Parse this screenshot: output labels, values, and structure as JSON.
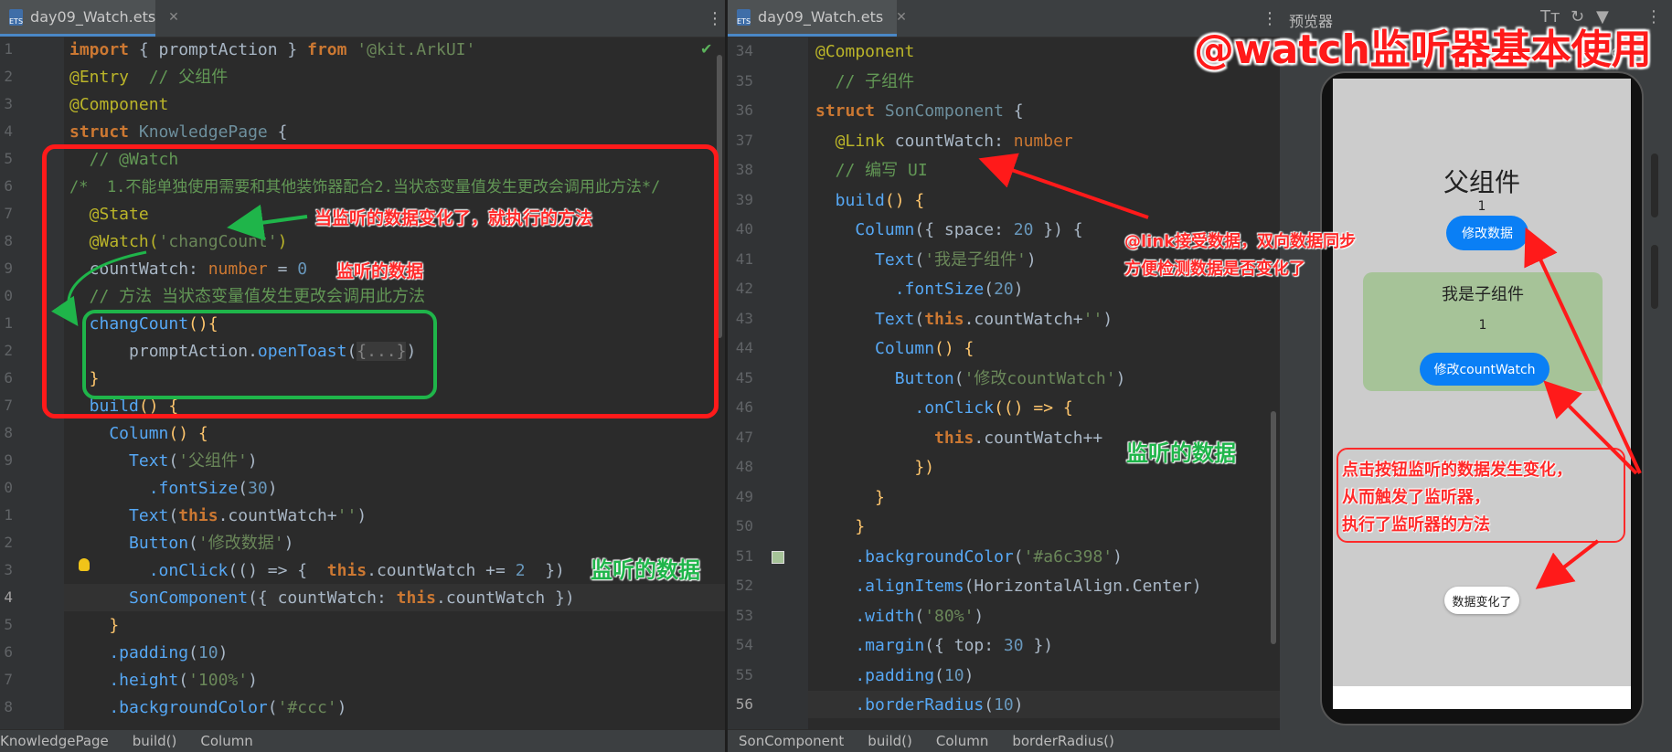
{
  "left_editor": {
    "tab": "day09_Watch.ets",
    "lines": [
      "1",
      "2",
      "3",
      "4",
      "5",
      "6",
      "7",
      "8",
      "9",
      "0",
      "1",
      "2",
      "6",
      "7",
      "8",
      "9",
      "0",
      "1",
      "2",
      "3",
      "4",
      "5",
      "6",
      "7",
      "8"
    ],
    "code": {
      "l1a": "import",
      "l1b": " { ",
      "l1c": "promptAction",
      "l1d": " } ",
      "l1e": "from",
      "l1f": " '@kit.ArkUI'",
      "l2a": "@Entry",
      "l2b": "  // 父组件",
      "l3": "@Component",
      "l4a": "struct",
      "l4b": " KnowledgePage",
      "l4c": " {",
      "l5": "  // @Watch",
      "l6": "/*  1.不能单独使用需要和其他装饰器配合2.当状态变量值发生更改会调用此方法*/",
      "l7": "  @State",
      "l8a": "  @Watch(",
      "l8b": "'changCount'",
      "l8c": ")",
      "l9a": "  countWatch: ",
      "l9b": "number",
      "l9c": " = ",
      "l9d": "0",
      "l10": "  // 方法 当状态变量值发生更改会调用此方法",
      "l11a": "  changCount",
      "l11b": "(){",
      "l12a": "      promptAction.",
      "l12b": "openToast",
      "l12c": "(",
      "l12d": "{...}",
      "l12e": ")",
      "l13": "  }",
      "l14a": "  build",
      "l14b": "() {",
      "l15a": "    Column",
      "l15b": "() {",
      "l16a": "      Text",
      "l16b": "(",
      "l16c": "'父组件'",
      "l16d": ")",
      "l17a": "        .fontSize",
      "l17b": "(",
      "l17c": "30",
      "l17d": ")",
      "l18a": "      Text",
      "l18b": "(",
      "l18c": "this",
      ".l18d": "",
      "l18d": ".countWatch+",
      "l18e": "''",
      "l18f": ")",
      "l19a": "      Button",
      "l19b": "(",
      "l19c": "'修改数据'",
      "l19d": ")",
      "l20a": "        .onClick",
      "l20b": "(() => {  ",
      "l20c": "this",
      "l20d": ".countWatch += ",
      "l20e": "2",
      "l20f": "  })",
      "l21a": "      SonComponent",
      "l21b": "({ countWatch: ",
      "l21c": "this",
      "l21d": ".countWatch })",
      "l22": "    }",
      "l23a": "    .padding",
      "l23b": "(",
      "l23c": "10",
      "l23d": ")",
      "l24a": "    .height",
      "l24b": "(",
      "l24c": "'100%'",
      "l24d": ")",
      "l25a": "    .backgroundColor",
      "l25b": "(",
      "l25c": "'#ccc'",
      "l25d": ")"
    },
    "status": [
      "KnowledgePage",
      "build()",
      "Column"
    ]
  },
  "right_editor": {
    "tab": "day09_Watch.ets",
    "lines": [
      "34",
      "35",
      "36",
      "37",
      "38",
      "39",
      "40",
      "41",
      "42",
      "43",
      "44",
      "45",
      "46",
      "47",
      "48",
      "49",
      "50",
      "51",
      "52",
      "53",
      "54",
      "55",
      "56"
    ],
    "code": {
      "r34": "@Component",
      "r35": "  // 子组件",
      "r36a": "struct",
      "r36b": " SonComponent",
      "r36c": " {",
      "r37a": "  @Link",
      "r37b": " countWatch: ",
      "r37c": "number",
      "r38": "  // 编写 UI",
      "r39a": "  build",
      "r39b": "() {",
      "r40a": "    Column",
      "r40b": "({ space: ",
      "r40c": "20",
      "r40d": " }) {",
      "r41a": "      Text",
      "r41b": "(",
      "r41c": "'我是子组件'",
      "r41d": ")",
      "r42a": "        .fontSize",
      "r42b": "(",
      "r42c": "20",
      "r42d": ")",
      "r43a": "      Text",
      "r43b": "(",
      "r43c": "this",
      "r43d": ".countWatch+",
      "r43e": "''",
      "r43f": ")",
      "r44a": "      Column",
      "r44b": "() {",
      "r45a": "        Button",
      "r45b": "(",
      "r45c": "'修改countWatch'",
      "r45d": ")",
      "r46a": "          .onClick",
      "r46b": "(() => {",
      "r47a": "            this",
      "r47b": ".countWatch++",
      "r48": "          })",
      "r49": "      }",
      "r50": "    }",
      "r51a": "    .backgroundColor",
      "r51b": "(",
      "r51c": "'#a6c398'",
      "r51d": ")",
      "r52a": "    .alignItems",
      "r52b": "(HorizontalAlign.Center)",
      "r53a": "    .width",
      "r53b": "(",
      "r53c": "'80%'",
      "r53d": ")",
      "r54a": "    .margin",
      "r54b": "({ top: ",
      "r54c": "30",
      "r54d": " })",
      "r55a": "    .padding",
      "r55b": "(",
      "r55c": "10",
      "r55d": ")",
      "r56a": "    .borderRadius",
      "r56b": "(",
      "r56c": "10",
      "r56d": ")"
    },
    "status": [
      "SonComponent",
      "build()",
      "Column",
      "borderRadius()"
    ]
  },
  "previewer": {
    "title": "预览器",
    "parent_title": "父组件",
    "count": "1",
    "parent_button": "修改数据",
    "child_title": "我是子组件",
    "child_count": "1",
    "child_button": "修改countWatch",
    "toast": "数据变化了"
  },
  "annotations": {
    "headline": "@watch监听器基本使用",
    "watch_note": "当监听的数据变化了，就执行的方法",
    "watched_data_1": "监听的数据",
    "watched_data_2": "监听的数据",
    "watched_data_3": "监听的数据",
    "link_note_1": "@link接受数据，双向数据同步",
    "link_note_2": "方便检测数据是否变化了",
    "trigger_1": "点击按钮监听的数据发生变化，",
    "trigger_2": "从而触发了监听器，",
    "trigger_3": "执行了监听器的方法"
  },
  "colors": {
    "annotation_red": "#ff1a1a",
    "annotation_green": "#1fb54a",
    "child_bg": "#a6c398",
    "parent_bg": "#cccccc",
    "button_blue": "#0a7ff5"
  }
}
